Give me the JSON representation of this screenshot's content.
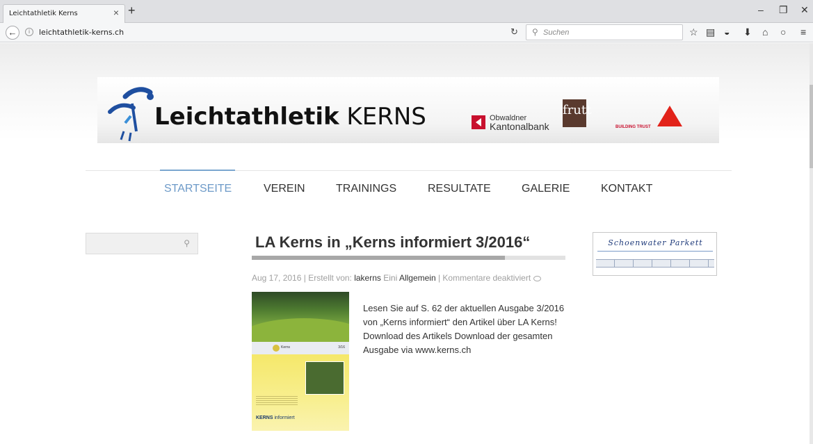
{
  "browser": {
    "tab_title": "Leichtathletik Kerns",
    "tab_close": "×",
    "new_tab": "+",
    "url": "leichtathletik-kerns.ch",
    "search_placeholder": "Suchen",
    "window_controls": [
      "–",
      "❐",
      "✕"
    ],
    "toolbar_icons": [
      "star-icon",
      "reading-list-icon",
      "pocket-icon",
      "download-icon",
      "home-icon",
      "chat-icon",
      "menu-icon"
    ]
  },
  "banner": {
    "title_bold": "Leichtathletik",
    "title_rest": " KERNS",
    "sponsor_okb_line1": "Obwaldner",
    "sponsor_okb_line2": "Kantonalbank",
    "sponsor_frutt": "frutt",
    "sponsor_sika_tagline": "BUILDING TRUST"
  },
  "nav": {
    "items": [
      "STARTSEITE",
      "VEREIN",
      "TRAININGS",
      "RESULTATE",
      "GALERIE",
      "KONTAKT"
    ],
    "active": "STARTSEITE",
    "active_color": "#6d9ac8"
  },
  "post": {
    "title": "LA Kerns in „Kerns informiert 3/2016“",
    "date": "Aug 17, 2016",
    "created_by_label": " | Erstellt von: ",
    "author": "lakerns",
    "category_prefix": "Eini",
    "category": "Allgemein",
    "comments": " | Kommentare deaktiviert",
    "body": "Lesen Sie auf S. 62 der aktuellen Ausgabe 3/2016 von „Kerns informiert“ den Artikel über LA Kerns!  Download des Artikels  Download der gesamten Ausgabe via www.kerns.ch",
    "thumbnail": {
      "band_label": "Kerns",
      "issue": "3/16",
      "caption_bold": "KERNS",
      "caption_rest": " informiert"
    }
  },
  "sidebar_ad": {
    "text": "Schoenwater Parkett"
  }
}
